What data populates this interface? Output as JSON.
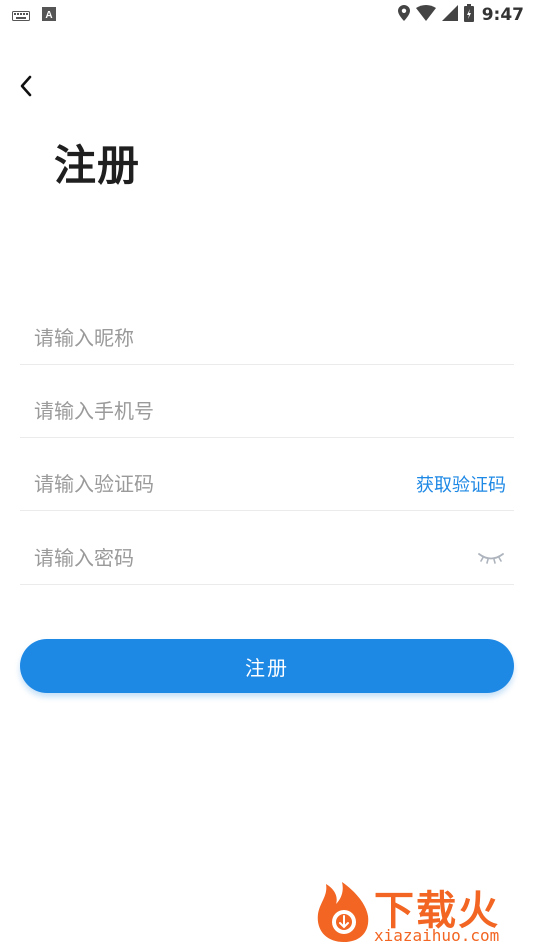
{
  "status_bar": {
    "time": "9:47",
    "icons": [
      "keyboard-icon",
      "text-a-icon",
      "location-icon",
      "wifi-icon",
      "cell-signal-icon",
      "battery-icon"
    ]
  },
  "header": {
    "back_icon": "chevron-left-icon",
    "title": "注册"
  },
  "form": {
    "nickname_placeholder": "请输入昵称",
    "phone_placeholder": "请输入手机号",
    "code_placeholder": "请输入验证码",
    "get_code_label": "获取验证码",
    "password_placeholder": "请输入密码",
    "password_toggle_icon": "eye-closed-icon",
    "submit_label": "注册"
  },
  "watermark": {
    "brand": "下载火",
    "domain": "xiazaihuo.com"
  },
  "colors": {
    "accent": "#1e88e5",
    "title": "#1f1f1f",
    "placeholder": "#9a9a9a",
    "divider": "#ebebeb",
    "watermark": "#f26522"
  }
}
